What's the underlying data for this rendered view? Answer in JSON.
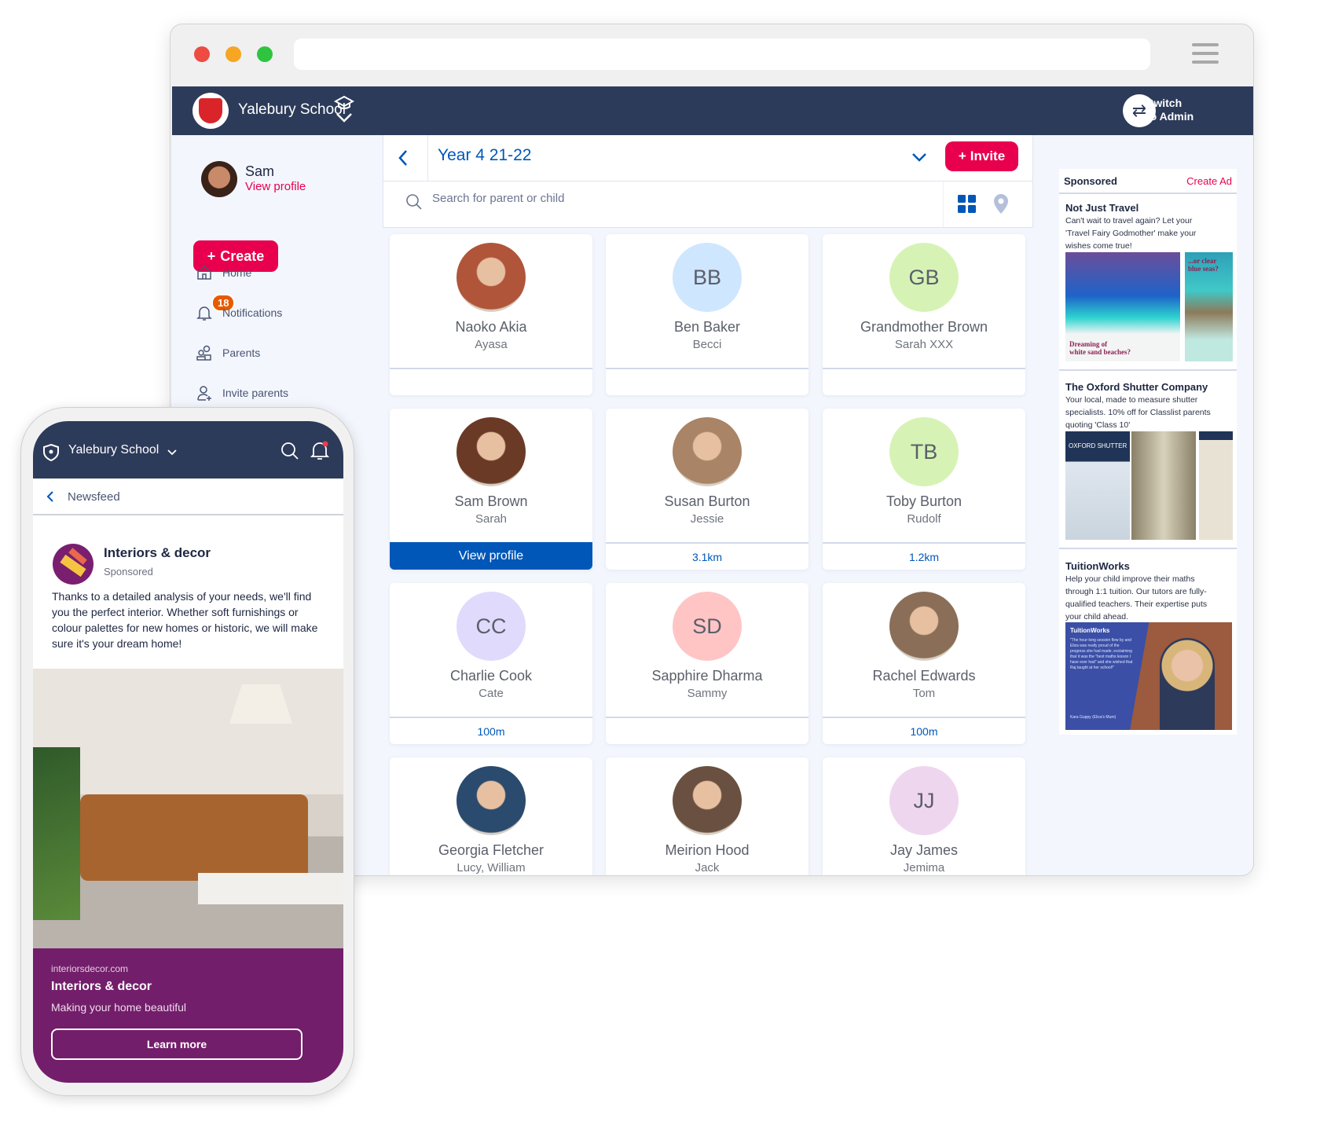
{
  "browser": {
    "traffic_lights": [
      "#ee4b43",
      "#f6a623",
      "#2ec43f"
    ]
  },
  "app": {
    "school_name": "Yalebury School",
    "switch_admin": {
      "line1": "Switch",
      "line2": "to Admin"
    },
    "colors": {
      "nav": "#2d3b5a",
      "accent": "#e8004f",
      "link": "#0057b8",
      "background": "#f3f6fd"
    }
  },
  "sidebar": {
    "user_name": "Sam",
    "view_profile": "View profile",
    "create_label": "Create",
    "notifications_count": "18",
    "items": [
      {
        "label": "Home",
        "icon": "home-icon"
      },
      {
        "label": "Notifications",
        "icon": "bell-icon"
      },
      {
        "label": "Parents",
        "icon": "parents-icon"
      },
      {
        "label": "Invite parents",
        "icon": "add-user-icon"
      }
    ]
  },
  "main": {
    "title": "Year 4 21-22",
    "invite_label": "Invite",
    "search_placeholder": "Search for parent or child",
    "cards": [
      {
        "name": "Naoko Akia",
        "children": "Ayasa",
        "photo": "#b0553a",
        "footer": ""
      },
      {
        "name": "Ben Baker",
        "children": "Becci",
        "initials": "BB",
        "color": "#cfe6ff",
        "footer": ""
      },
      {
        "name": "Grandmother Brown",
        "children": "Sarah XXX",
        "initials": "GB",
        "color": "#d6f3b5",
        "footer": ""
      },
      {
        "name": "Sam Brown",
        "children": "Sarah",
        "photo": "#6b3a26",
        "footer": "View profile",
        "footer_button": true
      },
      {
        "name": "Susan Burton",
        "children": "Jessie",
        "photo": "#a98466",
        "footer": "3.1km"
      },
      {
        "name": "Toby Burton",
        "children": "Rudolf",
        "initials": "TB",
        "color": "#d6f3b5",
        "footer": "1.2km"
      },
      {
        "name": "Charlie Cook",
        "children": "Cate",
        "initials": "CC",
        "color": "#e0dafc",
        "footer": "100m"
      },
      {
        "name": "Sapphire Dharma",
        "children": "Sammy",
        "initials": "SD",
        "color": "#ffc5c5",
        "footer": ""
      },
      {
        "name": "Rachel Edwards",
        "children": "Tom",
        "photo": "#8a6e58",
        "footer": "100m"
      },
      {
        "name": "Georgia Fletcher",
        "children": "Lucy, William",
        "photo": "#2a4a6e",
        "footer": ""
      },
      {
        "name": "Meirion Hood",
        "children": "Jack",
        "photo": "#6a5040",
        "footer": ""
      },
      {
        "name": "Jay James",
        "children": "Jemima",
        "initials": "JJ",
        "color": "#efd6ef",
        "footer": ""
      }
    ]
  },
  "ads": {
    "header": "Sponsored",
    "create_ad": "Create Ad",
    "items": [
      {
        "title": "Not Just Travel",
        "lines": [
          "Can't wait to travel again? Let your",
          "'Travel Fairy Godmother' make your",
          "wishes come true!"
        ],
        "image_text": [
          "Dreaming of",
          "white sand beaches?",
          "...or clear",
          "blue seas?"
        ]
      },
      {
        "title": "The Oxford Shutter Company",
        "lines": [
          "Your local, made to measure shutter",
          "specialists. 10% off for Classlist parents",
          "quoting 'Class 10'"
        ],
        "image_text": [
          "OXFORD SHUTTER"
        ]
      },
      {
        "title": "TuitionWorks",
        "lines": [
          "Help your child improve their maths",
          "through 1:1 tuition. Our tutors are fully-",
          "qualified teachers. Their expertise puts",
          "your child ahead."
        ],
        "image_text": [
          "TuitionWorks",
          "\"The hour-long session flew by and Eliza was really proud of the progress she had made, exclaiming that it was the \"best maths lesson I have ever had\" and she wished that Raj taught at her school!\"",
          "Kara Guppy (Eliza's Mum)"
        ]
      }
    ]
  },
  "phone": {
    "school_name": "Yalebury School",
    "back_label": "Newsfeed",
    "post": {
      "title": "Interiors & decor",
      "sponsored": "Sponsored",
      "body": "Thanks to a detailed analysis of your needs, we'll find you the perfect interior. Whether soft furnishings or colour palettes for new homes or historic, we will make sure it's your dream home!",
      "url": "interiorsdecor.com",
      "cta_title": "Interiors & decor",
      "cta_subtitle": "Making your home beautiful",
      "cta_button": "Learn more",
      "brand_color": "#731e6b"
    }
  }
}
